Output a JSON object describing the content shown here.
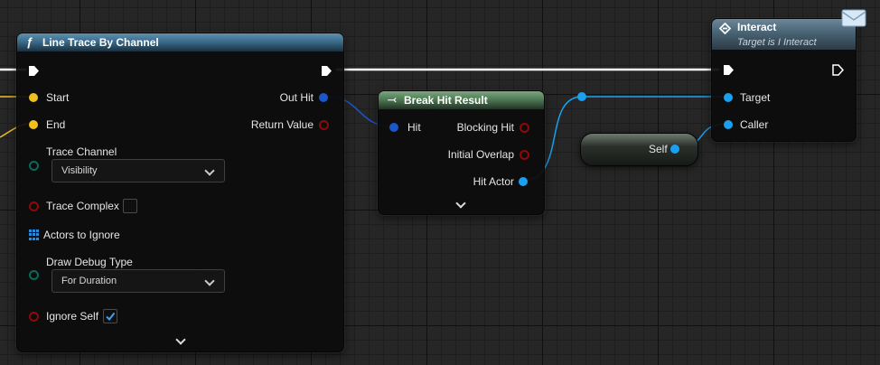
{
  "colors": {
    "exec_wire": "#ffffff",
    "struct_pin": "#1a58c8",
    "object_pin": "#1aa0f0",
    "vector_pin": "#f0c020",
    "bool_pin": "#8c0a0a",
    "enum_pin": "#0a6a5a"
  },
  "line_trace": {
    "title": "Line Trace By Channel",
    "icon": "function-icon",
    "inputs": {
      "start": "Start",
      "end": "End",
      "trace_channel": "Trace Channel",
      "trace_channel_value": "Visibility",
      "trace_complex": "Trace Complex",
      "trace_complex_checked": false,
      "actors_to_ignore": "Actors to Ignore",
      "draw_debug_type": "Draw Debug Type",
      "draw_debug_type_value": "For Duration",
      "ignore_self": "Ignore Self",
      "ignore_self_checked": true
    },
    "outputs": {
      "out_hit": "Out Hit",
      "return_value": "Return Value"
    }
  },
  "break_hit": {
    "title": "Break Hit Result",
    "icon": "break-struct-icon",
    "input_hit": "Hit",
    "outputs": {
      "blocking_hit": "Blocking Hit",
      "initial_overlap": "Initial Overlap",
      "hit_actor": "Hit Actor"
    }
  },
  "self_node": {
    "label": "Self"
  },
  "interact": {
    "title": "Interact",
    "subtitle": "Target is I Interact",
    "icon": "interface-message-icon",
    "badge_icon": "envelope-icon",
    "inputs": {
      "target": "Target",
      "caller": "Caller"
    }
  }
}
